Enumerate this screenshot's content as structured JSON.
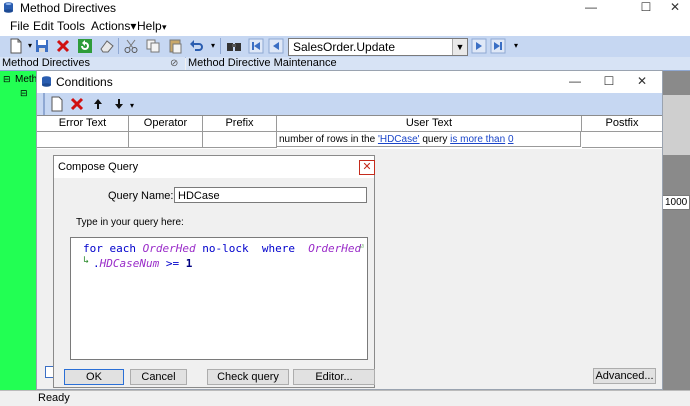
{
  "main_window": {
    "title": "Method Directives",
    "controls": {
      "minimize": "—",
      "maximize": "☐",
      "close": "✕"
    }
  },
  "menu": [
    "File",
    "Edit",
    "Tools",
    "Actions▾",
    "Help"
  ],
  "menu_overflow": "▾",
  "toolbar": {
    "directive_select_value": "SalesOrder.Update",
    "overflow": "▾"
  },
  "panels": {
    "left_header": "Method Directives",
    "right_header": "Method Directive Maintenance",
    "tree_item": "Meth"
  },
  "status_bar": {
    "text": "Ready"
  },
  "right_field_value": "1000",
  "advanced_button": "Advanced...",
  "conditions_window": {
    "title": "Conditions",
    "controls": {
      "minimize": "—",
      "maximize": "☐",
      "close": "✕"
    },
    "grid": {
      "headers": [
        "Error Text",
        "Operator",
        "Prefix",
        "User Text",
        "Postfix"
      ],
      "row": {
        "user_text_prefix": "number of rows in the ",
        "query_link": "'HDCase'",
        "mid_text": " query ",
        "comparison_link": "is more than",
        "space": " ",
        "value_link": "0"
      }
    }
  },
  "compose_query": {
    "title": "Compose Query",
    "close": "✕",
    "query_name_label": "Query Name:",
    "query_name_value": "HDCase",
    "instruction": "Type in your query here:",
    "code": {
      "line1": [
        {
          "t": "for each ",
          "c": "kw"
        },
        {
          "t": "OrderHed",
          "c": "id"
        },
        {
          "t": " no-lock  ",
          "c": "kw"
        },
        {
          "t": "where  ",
          "c": "kw"
        },
        {
          "t": "OrderHed",
          "c": "id"
        }
      ],
      "line2": [
        {
          "t": ".",
          "c": "kw"
        },
        {
          "t": "HDCaseNum",
          "c": "id"
        },
        {
          "t": " >= ",
          "c": "kw"
        },
        {
          "t": "1",
          "c": "num"
        }
      ]
    },
    "buttons": {
      "ok": "OK",
      "cancel": "Cancel",
      "check": "Check query",
      "editor": "Editor..."
    }
  }
}
